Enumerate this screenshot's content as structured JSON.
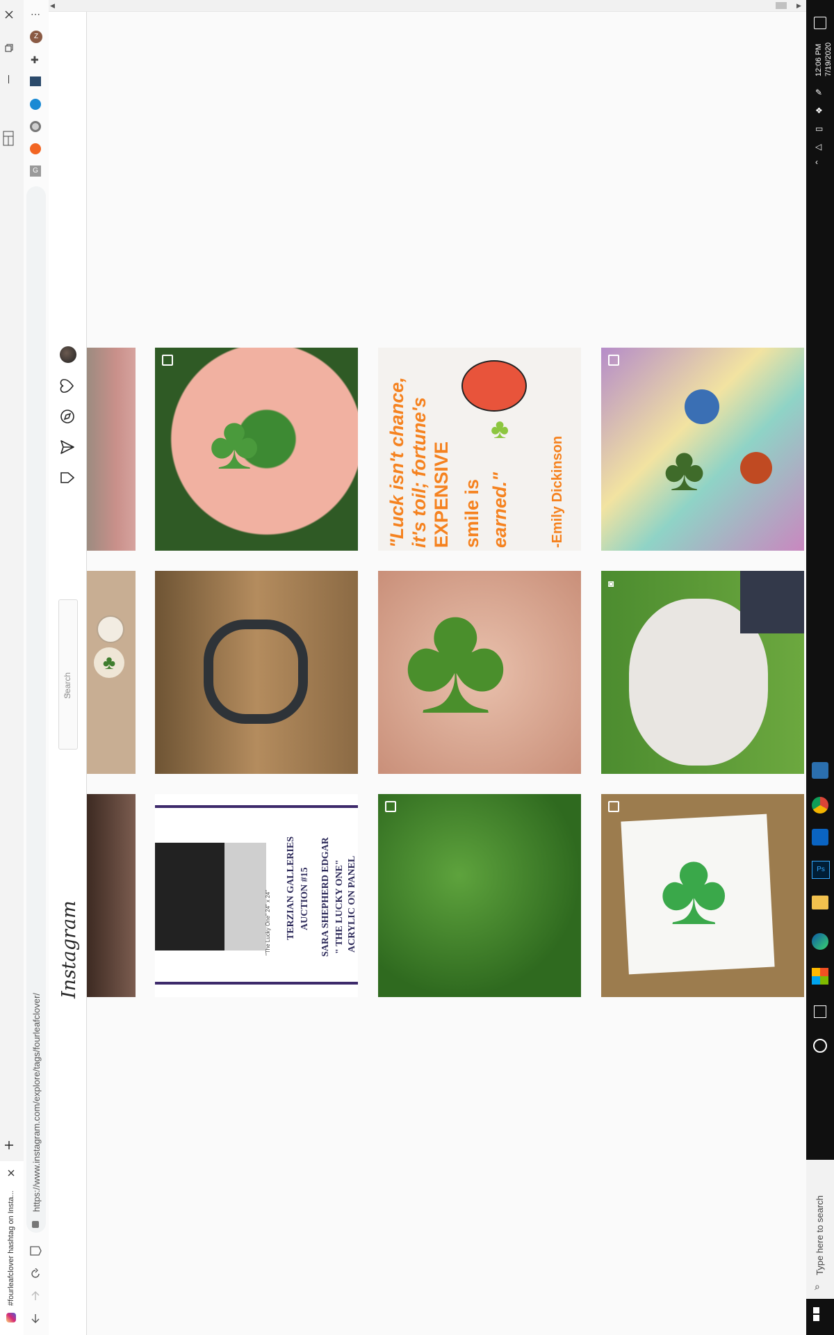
{
  "browser": {
    "active_tab_title": "#fourleafclover hashtag on Insta...",
    "url": "https://www.instagram.com/explore/tags/fourleafclover/",
    "avatar_initial": "Z",
    "extension_letter": "G"
  },
  "instagram": {
    "logo_text": "Instagram",
    "search_placeholder": "Search"
  },
  "posts": [
    {
      "kind": "clover-hands",
      "badge": "carousel"
    },
    {
      "kind": "quote",
      "badge": "none",
      "quote_lines": [
        "\"Luck isn't chance,",
        "it's toil; fortune's",
        "EXPENSIVE",
        "smile is",
        "earned.\""
      ],
      "quote_author": "-Emily Dickinson"
    },
    {
      "kind": "art",
      "badge": "carousel"
    },
    {
      "kind": "horseshoe",
      "badge": "none"
    },
    {
      "kind": "clover-leaf",
      "badge": "none"
    },
    {
      "kind": "dog",
      "badge": "video"
    },
    {
      "kind": "auction",
      "badge": "none",
      "lines": [
        "TERZIAN GALLERIES",
        "AUCTION #15",
        "SARA SHEPHERD EDGAR",
        "\" THE LUCKY ONE\"",
        "ACRYLIC ON PANEL"
      ],
      "caption": "\"The Lucky One\" 24\" x 24\""
    },
    {
      "kind": "grass",
      "badge": "carousel"
    },
    {
      "kind": "drawing",
      "badge": "carousel"
    }
  ],
  "taskbar": {
    "time": "12:06 PM",
    "date": "7/19/2020",
    "search_placeholder": "Type here to search"
  },
  "colors": {
    "accent": "#f5821f",
    "ig_bg": "#fafafa",
    "taskbar": "#101010"
  }
}
